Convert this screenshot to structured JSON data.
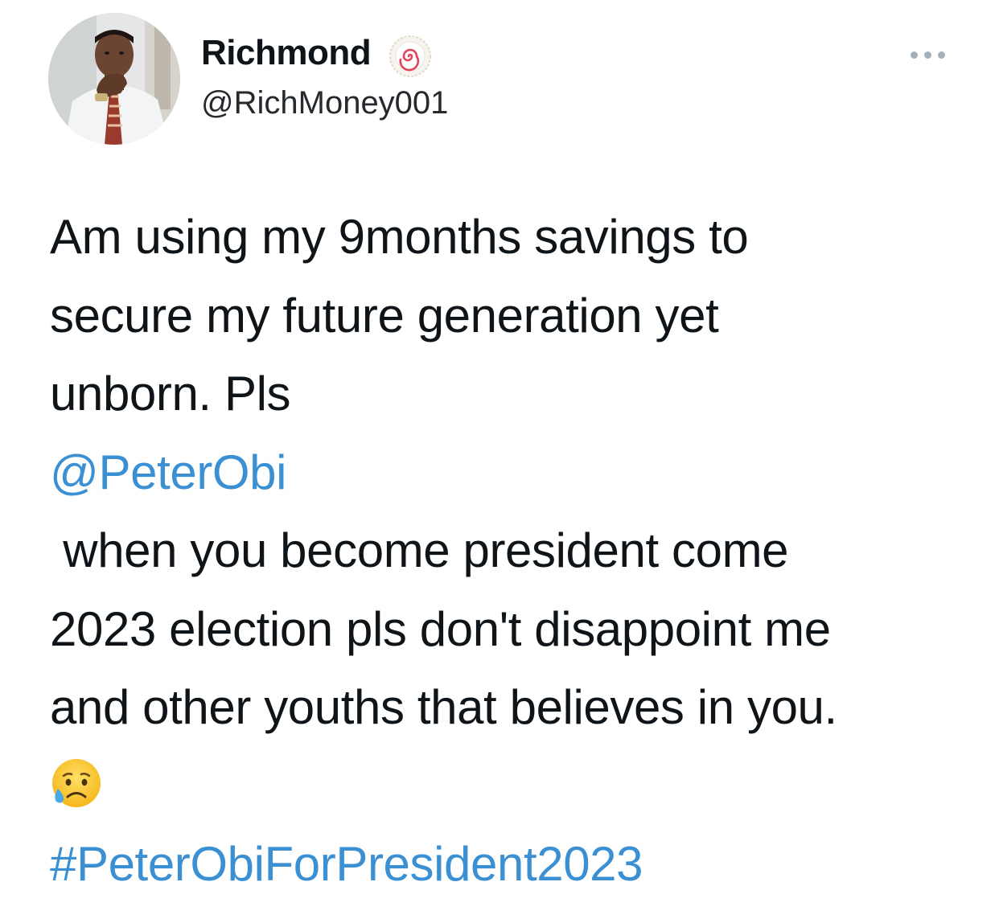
{
  "author": {
    "display_name": "Richmond",
    "handle": "@RichMoney001",
    "badge_icon": "swirl-badge-icon"
  },
  "menu": {
    "more_icon": "more-options-icon"
  },
  "tweet": {
    "line1": "Am using my 9months savings to",
    "line2": "secure my future generation yet",
    "line3": "unborn. Pls",
    "mention": "@PeterObi",
    "line5": " when you become president come",
    "line6": "2023 election pls don't disappoint me",
    "line7": "and other youths that believes in you.",
    "emoji": "sad-but-relieved-face-emoji",
    "hashtag": "#PeterObiForPresident2023"
  },
  "colors": {
    "text": "#0f1419",
    "link": "#3b8fd3",
    "muted": "#a5b0ba"
  }
}
